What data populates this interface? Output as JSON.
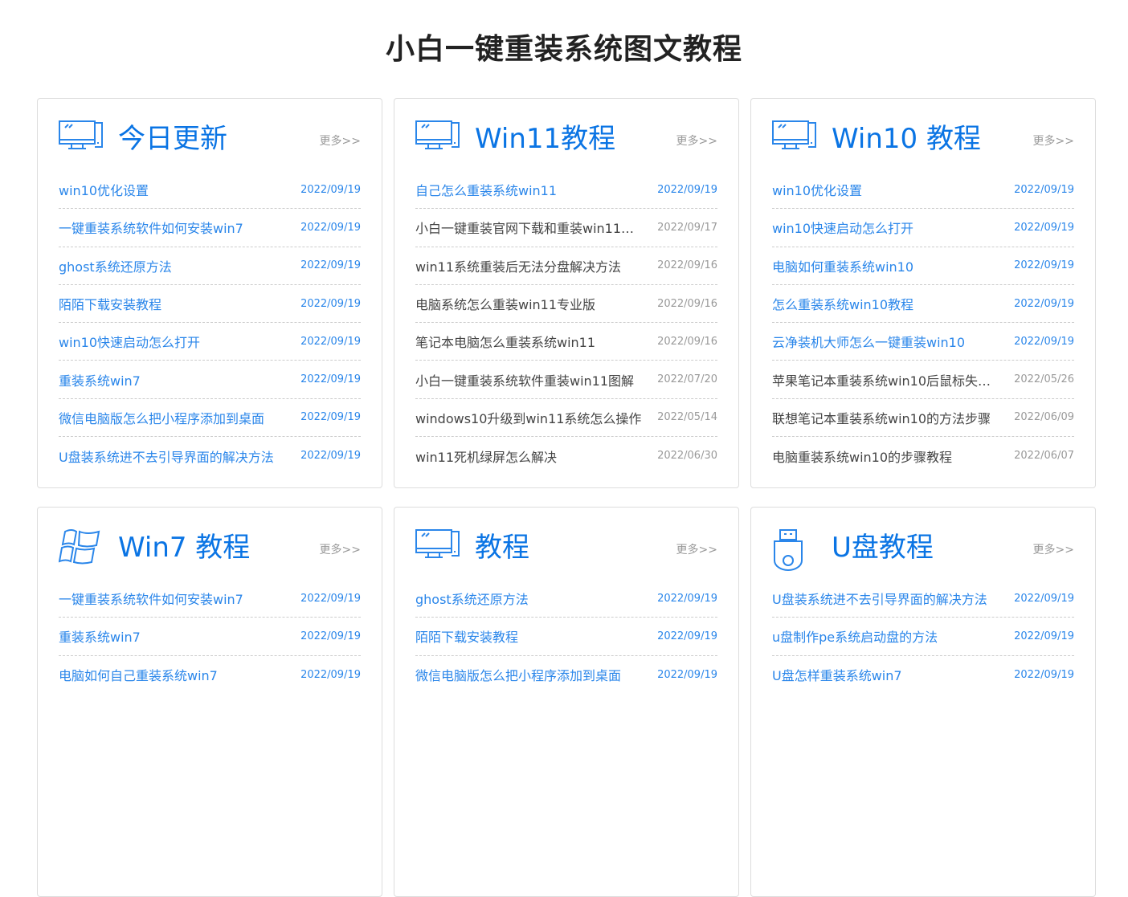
{
  "page_title": "小白一键重装系统图文教程",
  "more_label": "更多>>",
  "cards": [
    {
      "title": "今日更新",
      "icon": "monitor-icon",
      "items": [
        {
          "t": "win10优化设置",
          "d": "2022/09/19",
          "today": true
        },
        {
          "t": "一键重装系统软件如何安装win7",
          "d": "2022/09/19",
          "today": true
        },
        {
          "t": "ghost系统还原方法",
          "d": "2022/09/19",
          "today": true
        },
        {
          "t": "陌陌下载安装教程",
          "d": "2022/09/19",
          "today": true
        },
        {
          "t": "win10快速启动怎么打开",
          "d": "2022/09/19",
          "today": true
        },
        {
          "t": "重装系统win7",
          "d": "2022/09/19",
          "today": true
        },
        {
          "t": "微信电脑版怎么把小程序添加到桌面",
          "d": "2022/09/19",
          "today": true
        },
        {
          "t": "U盘装系统进不去引导界面的解决方法",
          "d": "2022/09/19",
          "today": true
        }
      ]
    },
    {
      "title": "Win11教程",
      "icon": "monitor-icon",
      "items": [
        {
          "t": "自己怎么重装系统win11",
          "d": "2022/09/19",
          "today": true
        },
        {
          "t": "小白一键重装官网下载和重装win11…",
          "d": "2022/09/17",
          "today": false
        },
        {
          "t": "win11系统重装后无法分盘解决方法",
          "d": "2022/09/16",
          "today": false
        },
        {
          "t": "电脑系统怎么重装win11专业版",
          "d": "2022/09/16",
          "today": false
        },
        {
          "t": "笔记本电脑怎么重装系统win11",
          "d": "2022/09/16",
          "today": false
        },
        {
          "t": "小白一键重装系统软件重装win11图解",
          "d": "2022/07/20",
          "today": false
        },
        {
          "t": "windows10升级到win11系统怎么操作",
          "d": "2022/05/14",
          "today": false
        },
        {
          "t": "win11死机绿屏怎么解决",
          "d": "2022/06/30",
          "today": false
        }
      ]
    },
    {
      "title": "Win10 教程",
      "icon": "monitor-icon",
      "items": [
        {
          "t": "win10优化设置",
          "d": "2022/09/19",
          "today": true
        },
        {
          "t": "win10快速启动怎么打开",
          "d": "2022/09/19",
          "today": true
        },
        {
          "t": "电脑如何重装系统win10",
          "d": "2022/09/19",
          "today": true
        },
        {
          "t": "怎么重装系统win10教程",
          "d": "2022/09/19",
          "today": true
        },
        {
          "t": "云净装机大师怎么一键重装win10",
          "d": "2022/09/19",
          "today": true
        },
        {
          "t": "苹果笔记本重装系统win10后鼠标失…",
          "d": "2022/05/26",
          "today": false
        },
        {
          "t": "联想笔记本重装系统win10的方法步骤",
          "d": "2022/06/09",
          "today": false
        },
        {
          "t": "电脑重装系统win10的步骤教程",
          "d": "2022/06/07",
          "today": false
        }
      ]
    },
    {
      "title": "Win7 教程",
      "icon": "windows-logo-icon",
      "items": [
        {
          "t": "一键重装系统软件如何安装win7",
          "d": "2022/09/19",
          "today": true
        },
        {
          "t": "重装系统win7",
          "d": "2022/09/19",
          "today": true
        },
        {
          "t": "电脑如何自己重装系统win7",
          "d": "2022/09/19",
          "today": true
        }
      ]
    },
    {
      "title": "教程",
      "icon": "monitor-icon",
      "items": [
        {
          "t": "ghost系统还原方法",
          "d": "2022/09/19",
          "today": true
        },
        {
          "t": "陌陌下载安装教程",
          "d": "2022/09/19",
          "today": true
        },
        {
          "t": "微信电脑版怎么把小程序添加到桌面",
          "d": "2022/09/19",
          "today": true
        }
      ]
    },
    {
      "title": "U盘教程",
      "icon": "usb-drive-icon",
      "items": [
        {
          "t": "U盘装系统进不去引导界面的解决方法",
          "d": "2022/09/19",
          "today": true
        },
        {
          "t": "u盘制作pe系统启动盘的方法",
          "d": "2022/09/19",
          "today": true
        },
        {
          "t": "U盘怎样重装系统win7",
          "d": "2022/09/19",
          "today": true
        }
      ]
    }
  ]
}
